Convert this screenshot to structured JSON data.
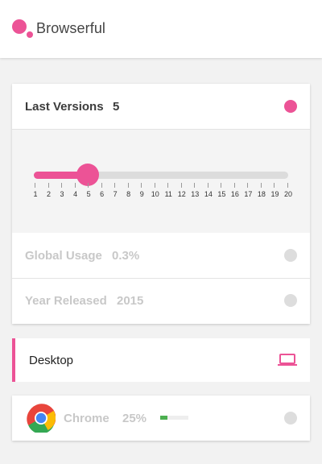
{
  "app": {
    "title": "Browserful",
    "accent": "#ec5396"
  },
  "versions_card": {
    "label": "Last Versions",
    "value": "5",
    "slider": {
      "min": 1,
      "max": 20,
      "value": 5,
      "tick_labels": [
        "1",
        "2",
        "3",
        "4",
        "5",
        "6",
        "7",
        "8",
        "9",
        "10",
        "11",
        "12",
        "13",
        "14",
        "15",
        "16",
        "17",
        "18",
        "19",
        "20"
      ]
    },
    "usage": {
      "label": "Global Usage",
      "value": "0.3%"
    },
    "year": {
      "label": "Year Released",
      "value": "2015"
    }
  },
  "platform": {
    "label": "Desktop",
    "icon": "laptop-icon"
  },
  "browser": {
    "name": "Chrome",
    "share": "25%",
    "share_fraction": 0.25,
    "icon": "chrome-icon",
    "bar_color": "#4caf50"
  }
}
